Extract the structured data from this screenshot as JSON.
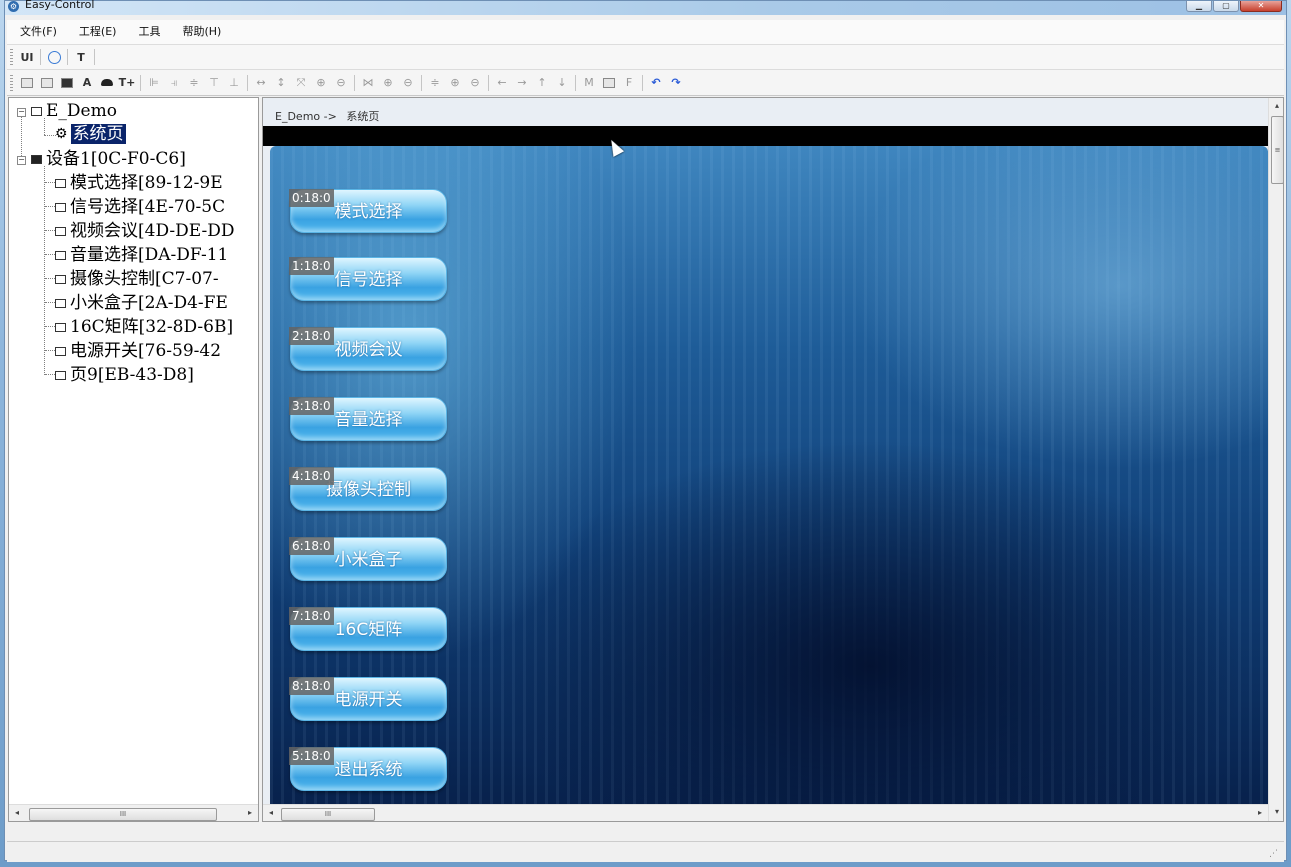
{
  "window": {
    "title": "Easy-Control",
    "controls": {
      "minimize": "▁",
      "maximize": "▢",
      "close": "✕"
    }
  },
  "menu": [
    "文件(F)",
    "工程(E)",
    "工具",
    "帮助(H)"
  ],
  "toolbar1": {
    "ui_label": "UI",
    "text_label": "T"
  },
  "toolbar2": {
    "a_label": "A",
    "tplus_label": "T+",
    "m_label": "M",
    "f_label": "F"
  },
  "tree": {
    "project": "E_Demo",
    "system_page": "系统页",
    "device": "设备1[0C-F0-C6]",
    "pages": [
      "模式选择[89-12-9E",
      "信号选择[4E-70-5C",
      "视频会议[4D-DE-DD",
      "音量选择[DA-DF-11",
      "摄像头控制[C7-07-",
      "小米盒子[2A-D4-FE",
      "16C矩阵[32-8D-6B]",
      "电源开关[76-59-42",
      "页9[EB-43-D8]"
    ]
  },
  "breadcrumb": {
    "project": "E_Demo",
    "arrow": "->",
    "page": "系统页"
  },
  "scroll": {
    "left": "◂",
    "right": "▸",
    "up": "▴",
    "down": "▾",
    "thumb": "III",
    "vthumb": "≡"
  },
  "buttons": [
    {
      "code": "0:18:0",
      "label": "模式选择"
    },
    {
      "code": "1:18:0",
      "label": "信号选择"
    },
    {
      "code": "2:18:0",
      "label": "视频会议"
    },
    {
      "code": "3:18:0",
      "label": "音量选择"
    },
    {
      "code": "4:18:0",
      "label": "摄像头控制"
    },
    {
      "code": "6:18:0",
      "label": "小米盒子"
    },
    {
      "code": "7:18:0",
      "label": "16C矩阵"
    },
    {
      "code": "8:18:0",
      "label": "电源开关"
    },
    {
      "code": "5:18:0",
      "label": "退出系统"
    }
  ],
  "colors": {
    "selection": "#0a246a",
    "button_top": "#dff5ff",
    "button_bottom": "#3aa2e2",
    "canvas_dark": "#071f49"
  }
}
